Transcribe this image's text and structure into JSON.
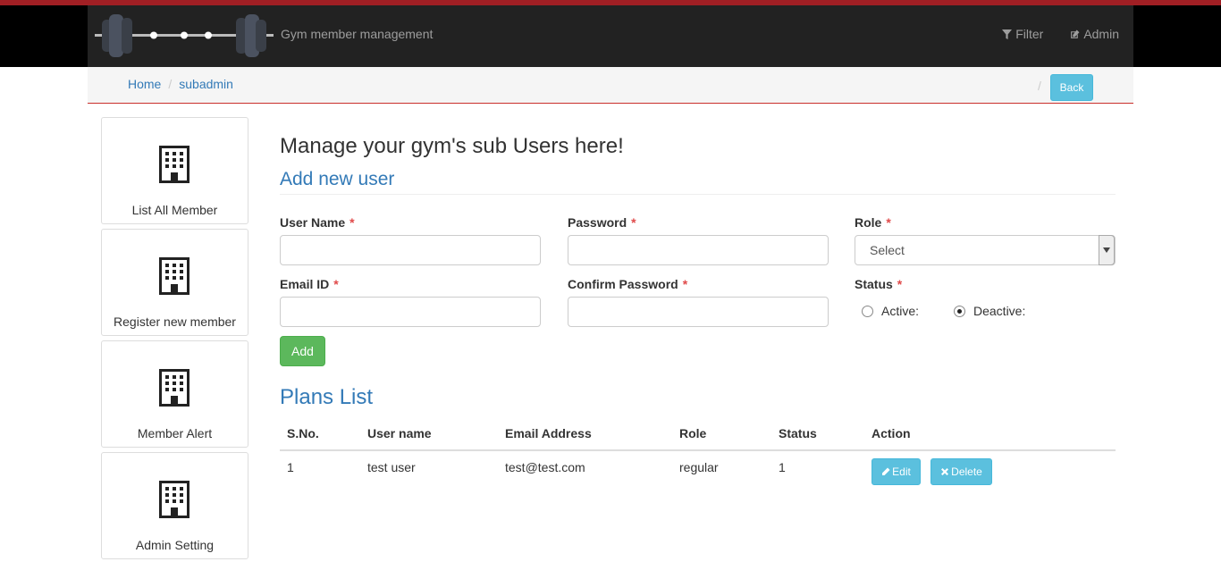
{
  "header": {
    "brand": "Gym member management",
    "filter_label": "Filter",
    "admin_label": "Admin"
  },
  "breadcrumb": {
    "items": [
      "Home",
      "subadmin"
    ],
    "back_label": "Back"
  },
  "sidebar": {
    "items": [
      {
        "label": "List All Member"
      },
      {
        "label": "Register new member"
      },
      {
        "label": "Member Alert"
      },
      {
        "label": "Admin Setting"
      }
    ]
  },
  "page": {
    "title": "Manage your gym's sub Users here!",
    "subtitle": "Add new user"
  },
  "form": {
    "username_label": "User Name",
    "password_label": "Password",
    "role_label": "Role",
    "role_selected": "Select",
    "email_label": "Email ID",
    "confirm_label": "Confirm Password",
    "status_label": "Status",
    "active_label": "Active:",
    "deactive_label": "Deactive:",
    "status_selected": "Deactive",
    "add_label": "Add",
    "required_mark": "*"
  },
  "plans": {
    "title": "Plans List",
    "columns": [
      "S.No.",
      "User name",
      "Email Address",
      "Role",
      "Status",
      "Action"
    ],
    "rows": [
      {
        "sno": "1",
        "username": "test user",
        "email": "test@test.com",
        "role": "regular",
        "status": "1"
      }
    ],
    "edit_label": "Edit",
    "delete_label": "Delete"
  },
  "colors": {
    "accent_red": "#a01f24",
    "link_blue": "#337ab7",
    "info": "#5bc0de",
    "success": "#5cb85c",
    "navbar": "#222222"
  },
  "icons": {
    "filter": "filter-icon",
    "admin": "edit-icon",
    "sidebar": "building-icon",
    "edit": "pencil-icon",
    "delete": "times-icon"
  }
}
